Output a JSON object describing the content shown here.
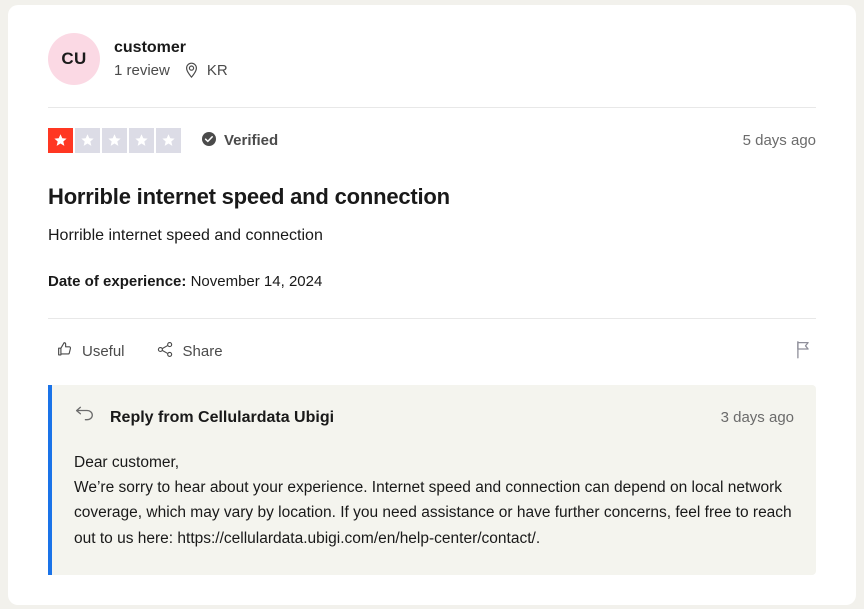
{
  "review": {
    "consumer": {
      "avatar_initials": "CU",
      "avatar_color": "#fbd9e4",
      "name": "customer",
      "review_count": "1 review",
      "location": "KR",
      "location_icon": "map-pin-icon"
    },
    "rating": {
      "value": 1,
      "max": 5,
      "filled_color": "#ff3722",
      "empty_color": "#dcdce6"
    },
    "verified_label": "Verified",
    "verified_icon": "check-circle-icon",
    "time_ago": "5 days ago",
    "title": "Horrible internet speed and connection",
    "body": "Horrible internet speed and connection",
    "experience": {
      "label": "Date of experience:",
      "value": "November 14, 2024"
    },
    "actions": {
      "useful_label": "Useful",
      "useful_icon": "thumbs-up-icon",
      "share_label": "Share",
      "share_icon": "share-nodes-icon",
      "report_icon": "flag-icon"
    },
    "reply": {
      "icon": "reply-arrow-icon",
      "title": "Reply from Cellulardata Ubigi",
      "time_ago": "3 days ago",
      "accent_color": "#1a73e8",
      "background_color": "#f4f4ee",
      "body": "Dear customer,\nWe’re sorry to hear about your experience. Internet speed and connection can depend on local network coverage, which may vary by location. If you need assistance or have further concerns, feel free to reach out to us here: https://cellulardata.ubigi.com/en/help-center/contact/."
    }
  }
}
